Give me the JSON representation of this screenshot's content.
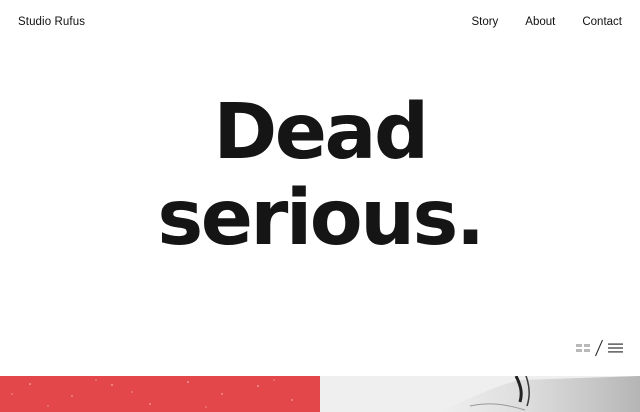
{
  "header": {
    "brand": "Studio Rufus",
    "nav": [
      "Story",
      "About",
      "Contact"
    ]
  },
  "hero": {
    "lines": [
      "Dead",
      "serious."
    ]
  },
  "view_toggle": {
    "icons": [
      "grid-view-icon",
      "slash-separator",
      "list-view-icon"
    ]
  },
  "tiles": {
    "left_color": "#e3474a",
    "right_color": "#efefef"
  }
}
